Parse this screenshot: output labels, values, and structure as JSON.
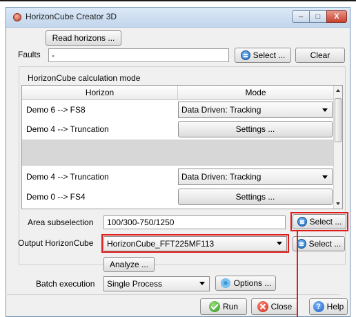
{
  "window": {
    "title": "HorizonCube Creator 3D",
    "controls": {
      "minimize": "–",
      "maximize": "□",
      "close": "X"
    }
  },
  "toolbar": {
    "read_horizons_label": "Read horizons ..."
  },
  "faults": {
    "label": "Faults",
    "value": "-",
    "select_label": "Select ...",
    "clear_label": "Clear"
  },
  "calc_mode": {
    "title": "HorizonCube calculation mode",
    "columns": [
      "Horizon",
      "Mode"
    ],
    "rows": [
      {
        "horizon": "Demo 6 --> FS8",
        "mode_type": "combo",
        "mode": "Data Driven: Tracking"
      },
      {
        "horizon": "Demo 4 --> Truncation",
        "mode_type": "button",
        "mode": "Settings ..."
      },
      {
        "horizon": "Demo 4 --> Truncation",
        "mode_type": "combo",
        "mode": "Data Driven: Tracking"
      },
      {
        "horizon": "Demo 0 --> FS4",
        "mode_type": "button",
        "mode": "Settings ..."
      }
    ]
  },
  "area": {
    "label": "Area subselection",
    "value": "100/300-750/1250",
    "select_label": "Select ..."
  },
  "output": {
    "label": "Output HorizonCube",
    "value": "HorizonCube_FFT225MF113",
    "select_label": "Select ..."
  },
  "analyze_label": "Analyze ...",
  "batch": {
    "label": "Batch execution",
    "value": "Single Process",
    "options_label": "Options ..."
  },
  "footer": {
    "run_label": "Run",
    "close_label": "Close",
    "help_label": "Help"
  },
  "colors": {
    "highlight": "#e01b1b",
    "accent": "#1f6fbf"
  }
}
